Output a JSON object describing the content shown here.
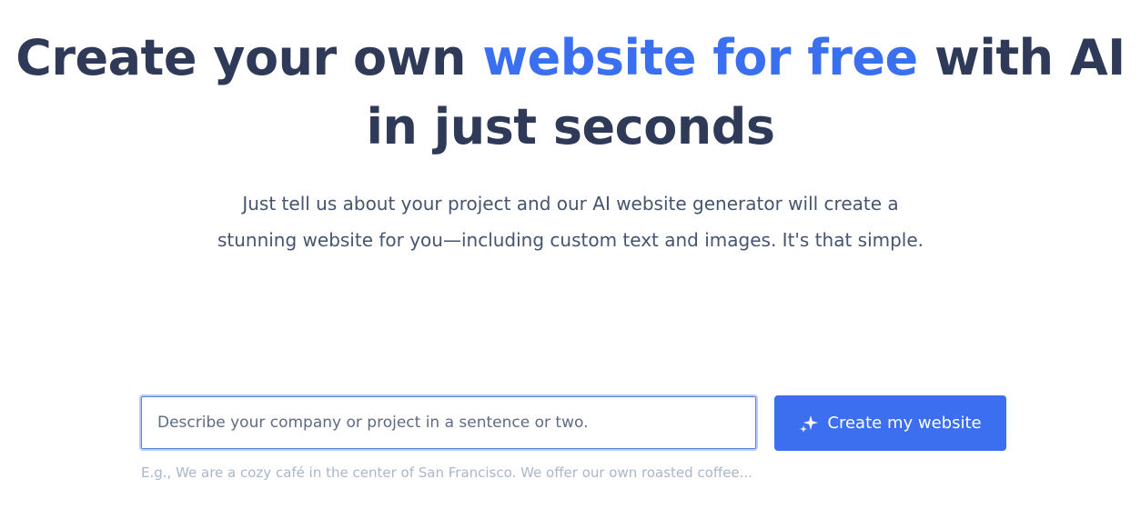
{
  "hero": {
    "headline_part1": "Create your own ",
    "headline_accent": "website for free",
    "headline_part2": " with AI in just seconds",
    "subtitle": "Just tell us about your project and our AI website generator will create a stunning website for you—including custom text and images. It's that simple."
  },
  "form": {
    "input_value": "",
    "input_placeholder": "Describe your company or project in a sentence or two.",
    "button_label": "Create my website",
    "button_icon": "sparkle-icon",
    "example_text": "E.g., We are a cozy café in the center of San Francisco. We offer our own roasted coffee..."
  },
  "colors": {
    "heading": "#2e3a57",
    "accent": "#3a6ff0",
    "button_bg": "#3b6ff0",
    "button_text": "#ffffff",
    "example_text": "#a9b6cb"
  }
}
